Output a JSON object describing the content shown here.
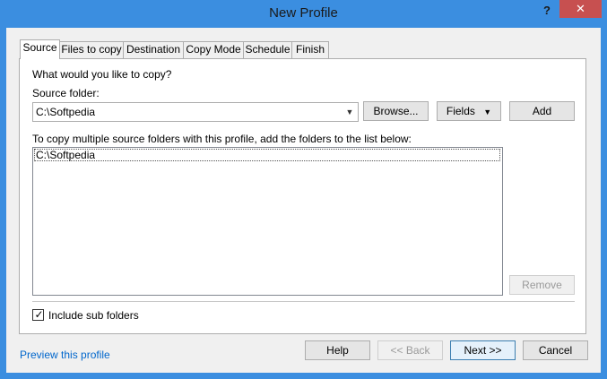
{
  "window": {
    "title": "New Profile",
    "help_glyph": "?",
    "close_glyph": "✕"
  },
  "tabs": [
    {
      "label": "Source",
      "active": true
    },
    {
      "label": "Files to copy",
      "active": false
    },
    {
      "label": "Destination",
      "active": false
    },
    {
      "label": "Copy Mode",
      "active": false
    },
    {
      "label": "Schedule",
      "active": false
    },
    {
      "label": "Finish",
      "active": false
    }
  ],
  "source": {
    "question": "What would you like to copy?",
    "folder_label": "Source folder:",
    "folder_value": "C:\\Softpedia",
    "browse_label": "Browse...",
    "fields_label": "Fields",
    "add_label": "Add",
    "list_hint": "To copy multiple source folders with this profile, add the folders to the list below:",
    "list_items": [
      "C:\\Softpedia"
    ],
    "remove_label": "Remove",
    "include_sub_label": "Include sub folders",
    "include_sub_checked": true
  },
  "footer": {
    "preview_link": "Preview this profile",
    "help_label": "Help",
    "back_label": "<< Back",
    "next_label": "Next >>",
    "cancel_label": "Cancel"
  },
  "colors": {
    "titlebar": "#3b8ee0",
    "close_button": "#c75050",
    "link": "#0066cc"
  }
}
